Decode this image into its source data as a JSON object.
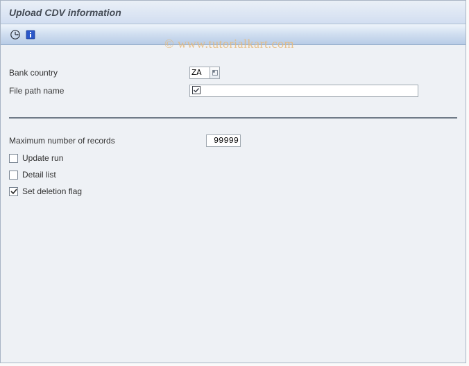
{
  "window": {
    "title": "Upload CDV information"
  },
  "watermark": "© www.tutorialkart.com",
  "toolbar": {
    "execute_icon": "execute-icon",
    "info_icon": "info-icon"
  },
  "fields": {
    "bank_country": {
      "label": "Bank country",
      "value": "ZA"
    },
    "file_path": {
      "label": "File path name",
      "value": ""
    },
    "max_records": {
      "label": "Maximum number of records",
      "value": "99999"
    }
  },
  "checkboxes": {
    "update_run": {
      "label": "Update run",
      "checked": false
    },
    "detail_list": {
      "label": "Detail list",
      "checked": false
    },
    "set_deletion_flag": {
      "label": "Set deletion flag",
      "checked": true
    }
  }
}
